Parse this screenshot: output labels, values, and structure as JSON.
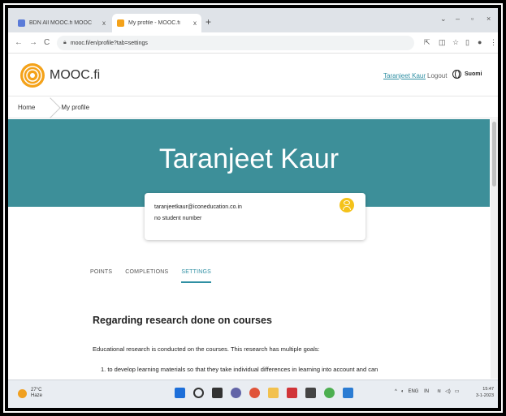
{
  "browser": {
    "tabs": [
      {
        "title": "BDN All MOOC.fi MOOC",
        "close": "x"
      },
      {
        "title": "My profile - MOOC.fi",
        "close": "x"
      }
    ],
    "new_tab": "+",
    "url": "mooc.fi/en/profile?tab=settings",
    "window_controls": [
      "⌄",
      "–",
      "▫",
      "×"
    ]
  },
  "site": {
    "brand": "MOOC.fi",
    "header_user": "Taranjeet Kaur",
    "logout": "Logout",
    "language": "Suomi"
  },
  "breadcrumb": [
    "Home",
    "My profile"
  ],
  "profile": {
    "name": "Taranjeet Kaur",
    "email": "taranjeetkaur@iconeducation.co.in",
    "student_number": "no student number"
  },
  "profile_tabs": [
    {
      "label": "POINTS",
      "active": false
    },
    {
      "label": "COMPLETIONS",
      "active": false
    },
    {
      "label": "SETTINGS",
      "active": true
    }
  ],
  "content": {
    "heading": "Regarding research done on courses",
    "paragraph": "Educational research is conducted on the courses. This research has multiple goals:",
    "list_item": "1. to develop learning materials so that they take individual differences in learning into account and can"
  },
  "taskbar": {
    "weather_temp": "27°C",
    "weather_desc": "Haze",
    "tray_lang": "ENG",
    "tray_region": "IN",
    "time": "15:47",
    "date": "3-1-2023"
  },
  "colors": {
    "banner": "#3d8f99",
    "accent": "#2f8fa3",
    "avatar": "#f4c21a"
  }
}
